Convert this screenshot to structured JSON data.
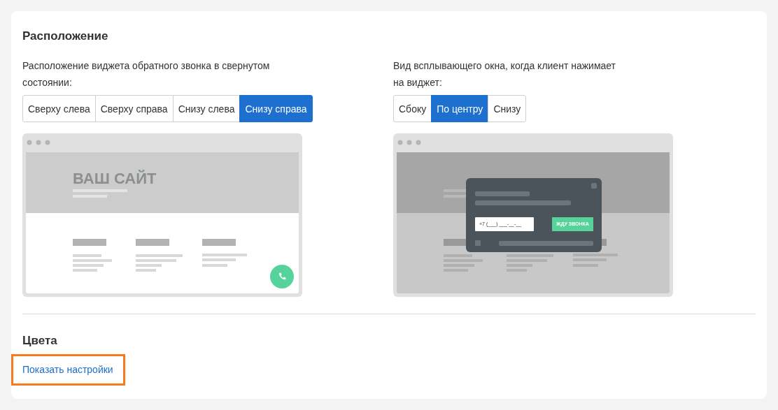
{
  "section_title": "Расположение",
  "position": {
    "label": "Расположение виджета обратного звонка в свернутом состоянии:",
    "options": [
      {
        "label": "Сверху слева",
        "selected": false
      },
      {
        "label": "Сверху справа",
        "selected": false
      },
      {
        "label": "Снизу слева",
        "selected": false
      },
      {
        "label": "Снизу справа",
        "selected": true
      }
    ],
    "preview": {
      "site_title": "ВАШ САЙТ"
    }
  },
  "popup": {
    "label": "Вид всплывающего окна, когда клиент нажимает на виджет:",
    "options": [
      {
        "label": "Сбоку",
        "selected": false
      },
      {
        "label": "По центру",
        "selected": true
      },
      {
        "label": "Снизу",
        "selected": false
      }
    ],
    "preview": {
      "phone_placeholder": "+7 (___) ___-__-__",
      "button": "ЖДУ ЗВОНКА"
    }
  },
  "colors": {
    "title": "Цвета",
    "link": "Показать настройки",
    "highlighted": true
  }
}
